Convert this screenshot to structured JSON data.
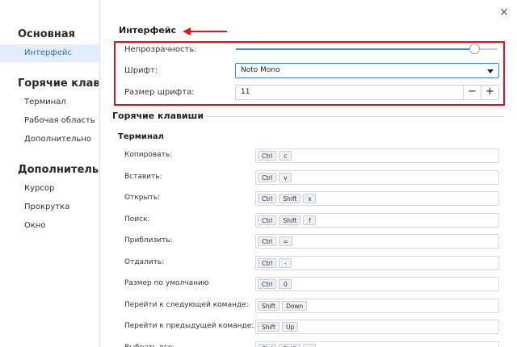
{
  "sidebar": {
    "groups": [
      {
        "title": "Основная",
        "items": [
          "Интерфейс"
        ]
      },
      {
        "title": "Горячие клави...",
        "items": [
          "Терминал",
          "Рабочая область",
          "Дополнительно"
        ]
      },
      {
        "title": "Дополнитель...",
        "items": [
          "Курсор",
          "Прокрутка",
          "Окно"
        ]
      }
    ],
    "active_item": "Интерфейс"
  },
  "window": {
    "close_icon": "close-icon",
    "close_glyph": "×"
  },
  "interface": {
    "title": "Интерфейс",
    "opacity_label": "Непрозрачность:",
    "opacity_value": 0.91,
    "font_label": "Шрифт:",
    "font_value": "Noto Mono",
    "font_size_label": "Размер шрифта:",
    "font_size_value": "11",
    "minus": "−",
    "plus": "+"
  },
  "hotkeys": {
    "title": "Горячие клавиши",
    "terminal_title": "Терминал",
    "rows": [
      {
        "label": "Копировать:",
        "keys": [
          "Ctrl",
          "c"
        ]
      },
      {
        "label": "Вставить:",
        "keys": [
          "Ctrl",
          "v"
        ]
      },
      {
        "label": "Открыть:",
        "keys": [
          "Ctrl",
          "Shift",
          "x"
        ]
      },
      {
        "label": "Поиск:",
        "keys": [
          "Ctrl",
          "Shift",
          "f"
        ]
      },
      {
        "label": "Приблизить:",
        "keys": [
          "Ctrl",
          "="
        ]
      },
      {
        "label": "Отдалить:",
        "keys": [
          "Ctrl",
          "-"
        ]
      },
      {
        "label": "Размер по умолчанию",
        "keys": [
          "Ctrl",
          "0"
        ]
      },
      {
        "label": "Перейти к следующей команде:",
        "keys": [
          "Shift",
          "Down"
        ]
      },
      {
        "label": "Перейти к предыдущей команде:",
        "keys": [
          "Shift",
          "Up"
        ]
      },
      {
        "label": "Выбрать все:",
        "keys": [
          "Ctrl",
          "Shift",
          "a"
        ]
      }
    ]
  },
  "colors": {
    "accent": "#3a86d6",
    "annotation": "#e0121b",
    "active_bg": "#e4eefa"
  }
}
